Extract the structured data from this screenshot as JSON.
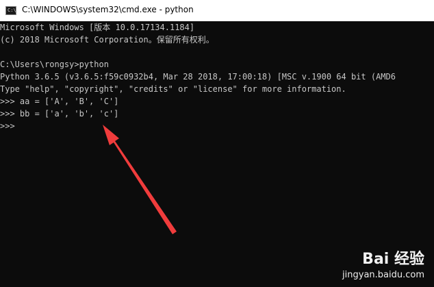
{
  "window": {
    "icon_label": "C:\\",
    "title": "C:\\WINDOWS\\system32\\cmd.exe - python"
  },
  "console": {
    "lines": [
      "Microsoft Windows [版本 10.0.17134.1184]",
      "(c) 2018 Microsoft Corporation。保留所有权利。",
      "",
      "C:\\Users\\rongsy>python",
      "Python 3.6.5 (v3.6.5:f59c0932b4, Mar 28 2018, 17:00:18) [MSC v.1900 64 bit (AMD6",
      "Type \"help\", \"copyright\", \"credits\" or \"license\" for more information.",
      ">>> aa = ['A', 'B', 'C']",
      ">>> bb = ['a', 'b', 'c']",
      ">>> "
    ]
  },
  "colors": {
    "console_bg": "#0c0c0c",
    "console_text": "#c8c8c8",
    "arrow": "#f03c3c"
  },
  "watermark": {
    "brand": "Bai 经验",
    "url": "jingyan.baidu.com"
  }
}
